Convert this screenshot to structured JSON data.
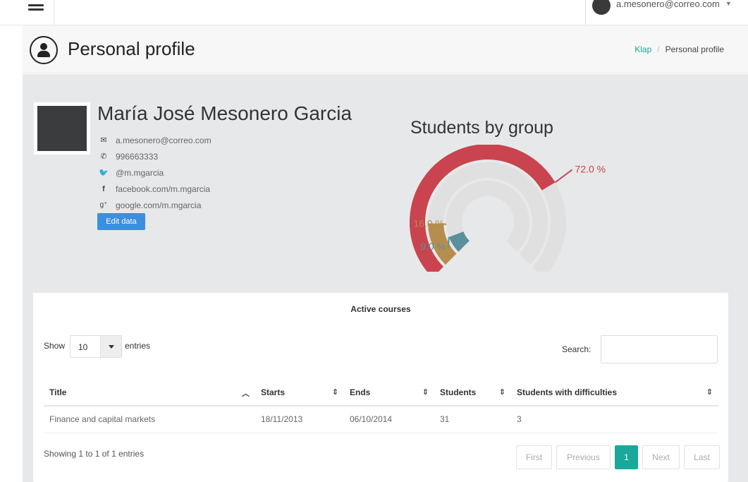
{
  "topbar": {
    "user_email": "a.mesonero@correo.com"
  },
  "header": {
    "title": "Personal profile",
    "breadcrumb": [
      "Klap",
      "Personal profile"
    ],
    "breadcrumb_link_color": "#1aa89a"
  },
  "profile": {
    "name": "María José Mesonero Garcia",
    "contacts": [
      {
        "icon": "envelope-icon",
        "text": "a.mesonero@correo.com"
      },
      {
        "icon": "phone-icon",
        "text": "996663333"
      },
      {
        "icon": "twitter-icon",
        "text": "@m.mgarcia"
      },
      {
        "icon": "facebook-icon",
        "text": "facebook.com/m.mgarcia"
      },
      {
        "icon": "google-plus-icon",
        "text": "google.com/m.mgarcia"
      }
    ],
    "edit_label": "Edit data",
    "edit_color": "#3d8ede"
  },
  "chart_data": {
    "type": "radial-bar",
    "title": "Students by group",
    "series": [
      {
        "label": "72.0 %",
        "value": 72.0,
        "color": "#c9444e"
      },
      {
        "label": "16.0 %",
        "value": 16.0,
        "color": "#b58d4e"
      },
      {
        "label": "9.0 %",
        "value": 9.0,
        "color": "#5c8f9c"
      }
    ],
    "track_color": "#e0e0e0"
  },
  "courses": {
    "title": "Active courses",
    "show_label": "Show",
    "entries_value": "10",
    "entries_label": "entries",
    "search_label": "Search:",
    "columns": [
      "Title",
      "Starts",
      "Ends",
      "Students",
      "Students with difficulties"
    ],
    "rows": [
      [
        "Finance and capital markets",
        "18/11/2013",
        "06/10/2014",
        "31",
        "3"
      ]
    ],
    "showing": "Showing 1 to 1 of 1 entries",
    "pager": [
      "First",
      "Previous",
      "1",
      "Next",
      "Last"
    ],
    "active_page": "1",
    "accent_color": "#1aa89a"
  }
}
